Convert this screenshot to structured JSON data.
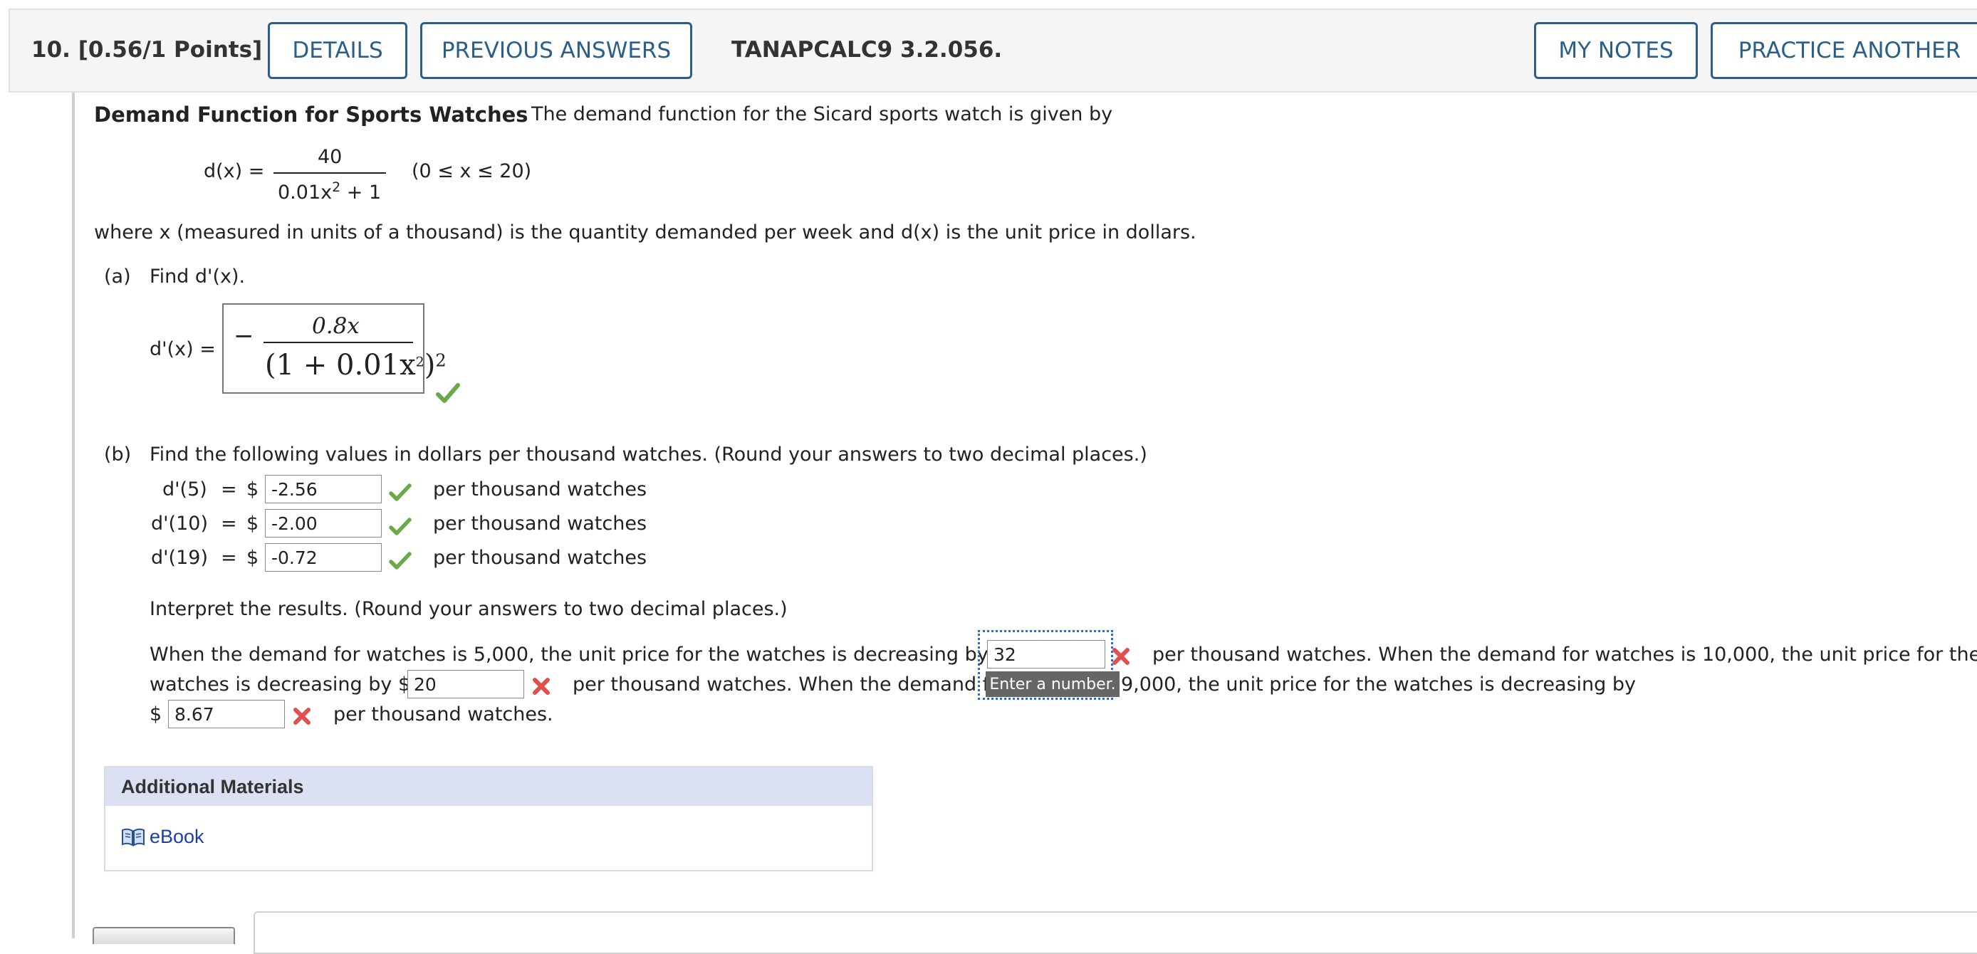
{
  "header": {
    "question_label": "10.  [0.56/1 Points]",
    "details_button": "DETAILS",
    "previous_answers_button": "PREVIOUS ANSWERS",
    "problem_code": "TANAPCALC9 3.2.056.",
    "my_notes_button": "MY NOTES",
    "practice_another_button": "PRACTICE ANOTHER"
  },
  "problem": {
    "title": "Demand Function for Sports Watches",
    "intro": "The demand function for the Sicard sports watch is given by",
    "func_lhs": "d(x) =",
    "func_numerator": "40",
    "func_denominator": "0.01x",
    "func_denominator_exp": "2",
    "func_denominator_tail": " + 1",
    "domain": "(0 ≤ x ≤ 20)",
    "where_text": "where x (measured in units of a thousand) is the quantity demanded per week and d(x) is the unit price in dollars."
  },
  "part_a": {
    "label": "(a)",
    "prompt": "Find d'(x).",
    "lhs": "d'(x) =",
    "answer_minus": "−",
    "answer_numerator": "0.8x",
    "answer_denominator": "(1 + 0.01x",
    "answer_denominator_exp": "2",
    "answer_denominator_close": ")",
    "answer_denominator_outer_exp": "2",
    "status": "correct"
  },
  "part_b": {
    "label": "(b)",
    "prompt": "Find the following values in dollars per thousand watches. (Round your answers to two decimal places.)",
    "rows": [
      {
        "lhs": "d'(5)",
        "eq": "=",
        "currency": "$",
        "value": "-2.56",
        "unit": "per thousand watches",
        "status": "correct"
      },
      {
        "lhs": "d'(10)",
        "eq": "=",
        "currency": "$",
        "value": "-2.00",
        "unit": "per thousand watches",
        "status": "correct"
      },
      {
        "lhs": "d'(19)",
        "eq": "=",
        "currency": "$",
        "value": "-0.72",
        "unit": "per thousand watches",
        "status": "correct"
      }
    ],
    "interpret_prompt": "Interpret the results. (Round your answers to two decimal places.)",
    "interp_line1_a": "When the demand for watches is 5,000, the unit price for the watches is decreasing by $",
    "interp_value1": "32",
    "interp_line1_b": "per thousand watches. When the demand for watches is 10,000, the unit price for the",
    "interp_line2_a": "watches is decreasing by $",
    "interp_value2": "20",
    "interp_line2_b": "per thousand watches. When the demand fo",
    "interp_line2_c": "9,000, the unit price for the watches is decreasing by",
    "interp_line3_a": "$",
    "interp_value3": "8.67",
    "interp_line3_b": "per thousand watches.",
    "tooltip": "Enter a number."
  },
  "materials": {
    "title": "Additional Materials",
    "ebook_label": "eBook"
  },
  "colors": {
    "accent": "#2a5f8a",
    "correct": "#6aaa4a",
    "incorrect": "#e0504f"
  }
}
